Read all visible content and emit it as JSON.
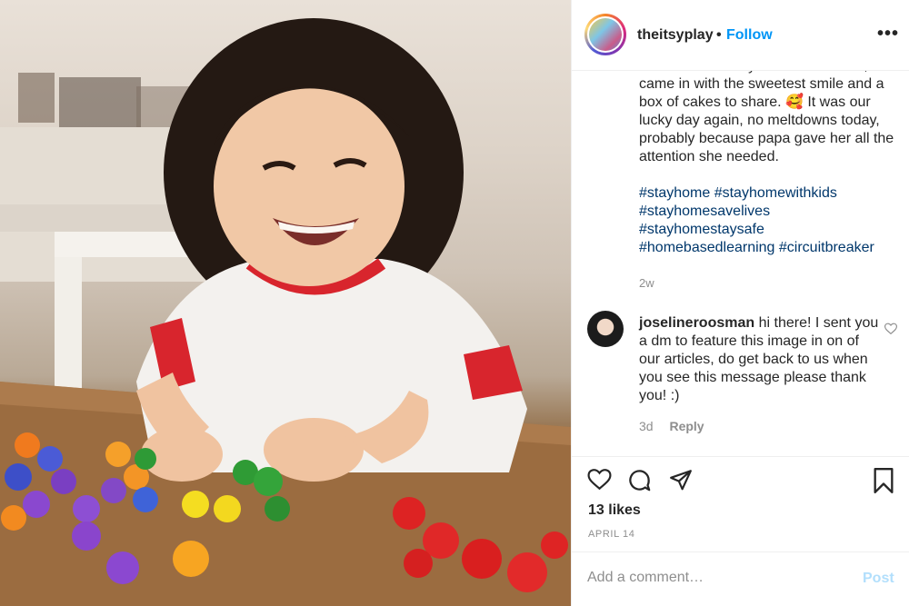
{
  "header": {
    "username": "theitsyplay",
    "separator": "•",
    "follow_label": "Follow",
    "more_label": "•••"
  },
  "caption": {
    "text": "And when the day was almost over, she came in with the sweetest smile and a box of cakes to share. 🥰  It was our lucky day again, no meltdowns today, probably because papa gave her all the attention she needed.",
    "hashtags": [
      "#stayhome #stayhomewithkids",
      "#stayhomesavelives",
      "#stayhomestaysafe",
      "#homebasedlearning #circuitbreaker"
    ],
    "age": "2w"
  },
  "comment": {
    "username": "joselineroosman",
    "text": " hi there! I sent you a dm to feature this image in on of our articles, do get back to us when you see this message please thank you! :)",
    "age": "3d",
    "reply_label": "Reply"
  },
  "actions": {
    "likes": "13 likes",
    "date": "APRIL 14"
  },
  "comment_box": {
    "placeholder": "Add a comment…",
    "post_label": "Post"
  },
  "colors": {
    "link": "#0095f6",
    "hashtag": "#00376b",
    "muted": "#8e8e8e",
    "post_disabled": "#b2dffc"
  },
  "icons": [
    "heart-icon",
    "comment-icon",
    "share-icon",
    "bookmark-icon",
    "more-icon"
  ]
}
